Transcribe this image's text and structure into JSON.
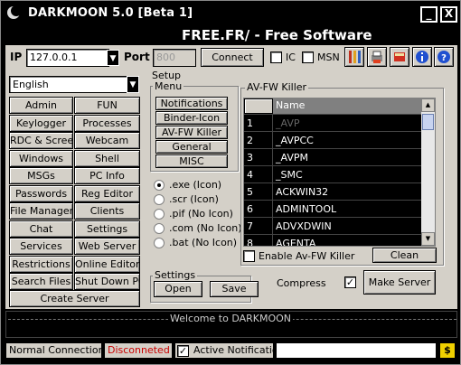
{
  "window": {
    "title": "DARKMOON 5.0 [Beta 1]",
    "banner": "FREE.FR/ - Free Software",
    "minimize_label": "_",
    "close_label": "X"
  },
  "connection": {
    "ip_label": "IP",
    "ip_value": "127.0.0.1",
    "port_label": "Port",
    "port_value": "800",
    "connect_label": "Connect",
    "ic_label": "IC",
    "msn_label": "MSN"
  },
  "language": {
    "selected": "English"
  },
  "commands": [
    [
      "Admin",
      "FUN"
    ],
    [
      "Keylogger",
      "Processes"
    ],
    [
      "RDC & Screen",
      "Webcam"
    ],
    [
      "Windows",
      "Shell"
    ],
    [
      "MSGs",
      "PC Info"
    ],
    [
      "Passwords",
      "Reg Editor"
    ],
    [
      "File Manager",
      "Clients"
    ],
    [
      "Chat",
      "Settings"
    ],
    [
      "Services",
      "Web Server"
    ],
    [
      "Restrictions",
      "Online Editor"
    ],
    [
      "Search Files",
      "Shut Down PC"
    ]
  ],
  "create_server_label": "Create Server",
  "setup": {
    "title": "Setup",
    "menu_title": "Menu",
    "menu_items": [
      "Notifications",
      "Binder-Icon",
      "AV-FW Killer",
      "General",
      "MISC"
    ],
    "extensions": [
      ".exe (Icon)",
      ".scr (Icon)",
      ".pif (No Icon)",
      ".com (No Icon)",
      ".bat (No Icon)"
    ],
    "selected_extension": 0,
    "settings_title": "Settings",
    "open_label": "Open",
    "save_label": "Save",
    "compress_label": "Compress",
    "compress_checked": true,
    "make_server_label": "Make Server"
  },
  "avfw": {
    "title": "AV-FW Killer",
    "column_name": "Name",
    "rows": [
      {
        "n": "1",
        "name": "_AVP"
      },
      {
        "n": "2",
        "name": "_AVPCC"
      },
      {
        "n": "3",
        "name": "_AVPM"
      },
      {
        "n": "4",
        "name": "_SMC"
      },
      {
        "n": "5",
        "name": "ACKWIN32"
      },
      {
        "n": "6",
        "name": "ADMINTOOL"
      },
      {
        "n": "7",
        "name": "ADVXDWIN"
      },
      {
        "n": "8",
        "name": "AGENTA"
      }
    ],
    "enable_label": "Enable Av-FW Killer",
    "clean_label": "Clean"
  },
  "log": {
    "message": "Welcome to DARKMOON"
  },
  "statusbar": {
    "connection": "Normal Connection",
    "state": "Disconneted",
    "notification_label": "Active Notification",
    "notification_checked": true,
    "end_icon_label": "$"
  },
  "colors": {
    "disconnected": "#cc0000",
    "client_bg": "#d4d0c8",
    "title_bg": "#000000"
  }
}
